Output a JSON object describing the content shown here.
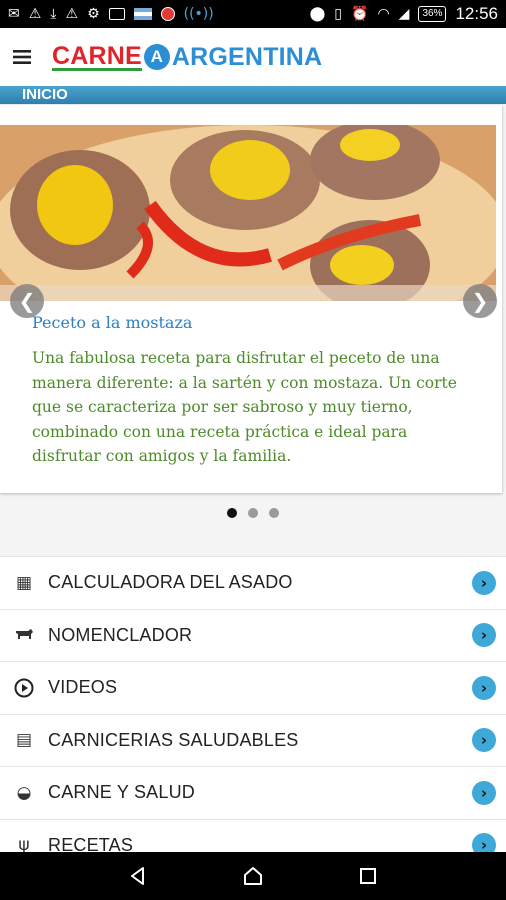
{
  "status_bar": {
    "battery": "36%",
    "time": "12:56",
    "icons_left": [
      "message-icon",
      "warning-icon",
      "download-icon",
      "warning-icon",
      "settings-icon",
      "sim-icon",
      "flag-icon",
      "record-icon",
      "wireless-icon"
    ],
    "icons_right": [
      "location-icon",
      "vibrate-icon",
      "alarm-icon",
      "wifi-icon",
      "signal-icon"
    ]
  },
  "header": {
    "logo_carne": "CARNE",
    "logo_mark": "A",
    "logo_argentina": "ARGENTINA"
  },
  "section": {
    "title": "INICIO"
  },
  "carousel": {
    "title": "Peceto a la mostaza",
    "description": "Una fabulosa receta para disfrutar el peceto de una manera diferente: a la sartén y con mostaza. Un corte que se caracteriza por ser sabroso y muy tierno, combinado con una receta práctica e ideal para disfrutar con amigos y la familia.",
    "prev_glyph": "❮",
    "next_glyph": "❯",
    "pages": 3,
    "active_page": 1
  },
  "menu": [
    {
      "label": "CALCULADORA DEL ASADO",
      "icon": "calculator-icon",
      "glyph": "▦"
    },
    {
      "label": "NOMENCLADOR",
      "icon": "cow-icon",
      "glyph": "🐄"
    },
    {
      "label": "VIDEOS",
      "icon": "play-icon",
      "glyph": "▷"
    },
    {
      "label": "CARNICERIAS SALUDABLES",
      "icon": "shop-icon",
      "glyph": "▤"
    },
    {
      "label": "CARNE Y SALUD",
      "icon": "dish-icon",
      "glyph": "◒"
    },
    {
      "label": "RECETAS",
      "icon": "fork-knife-icon",
      "glyph": "ψ"
    }
  ],
  "colors": {
    "accent_blue": "#2c8fd6",
    "brand_red": "#e0242b",
    "title_blue": "#2c7fc4",
    "desc_green": "#4d8a2a",
    "chevron_blue": "#3ea8d8"
  }
}
